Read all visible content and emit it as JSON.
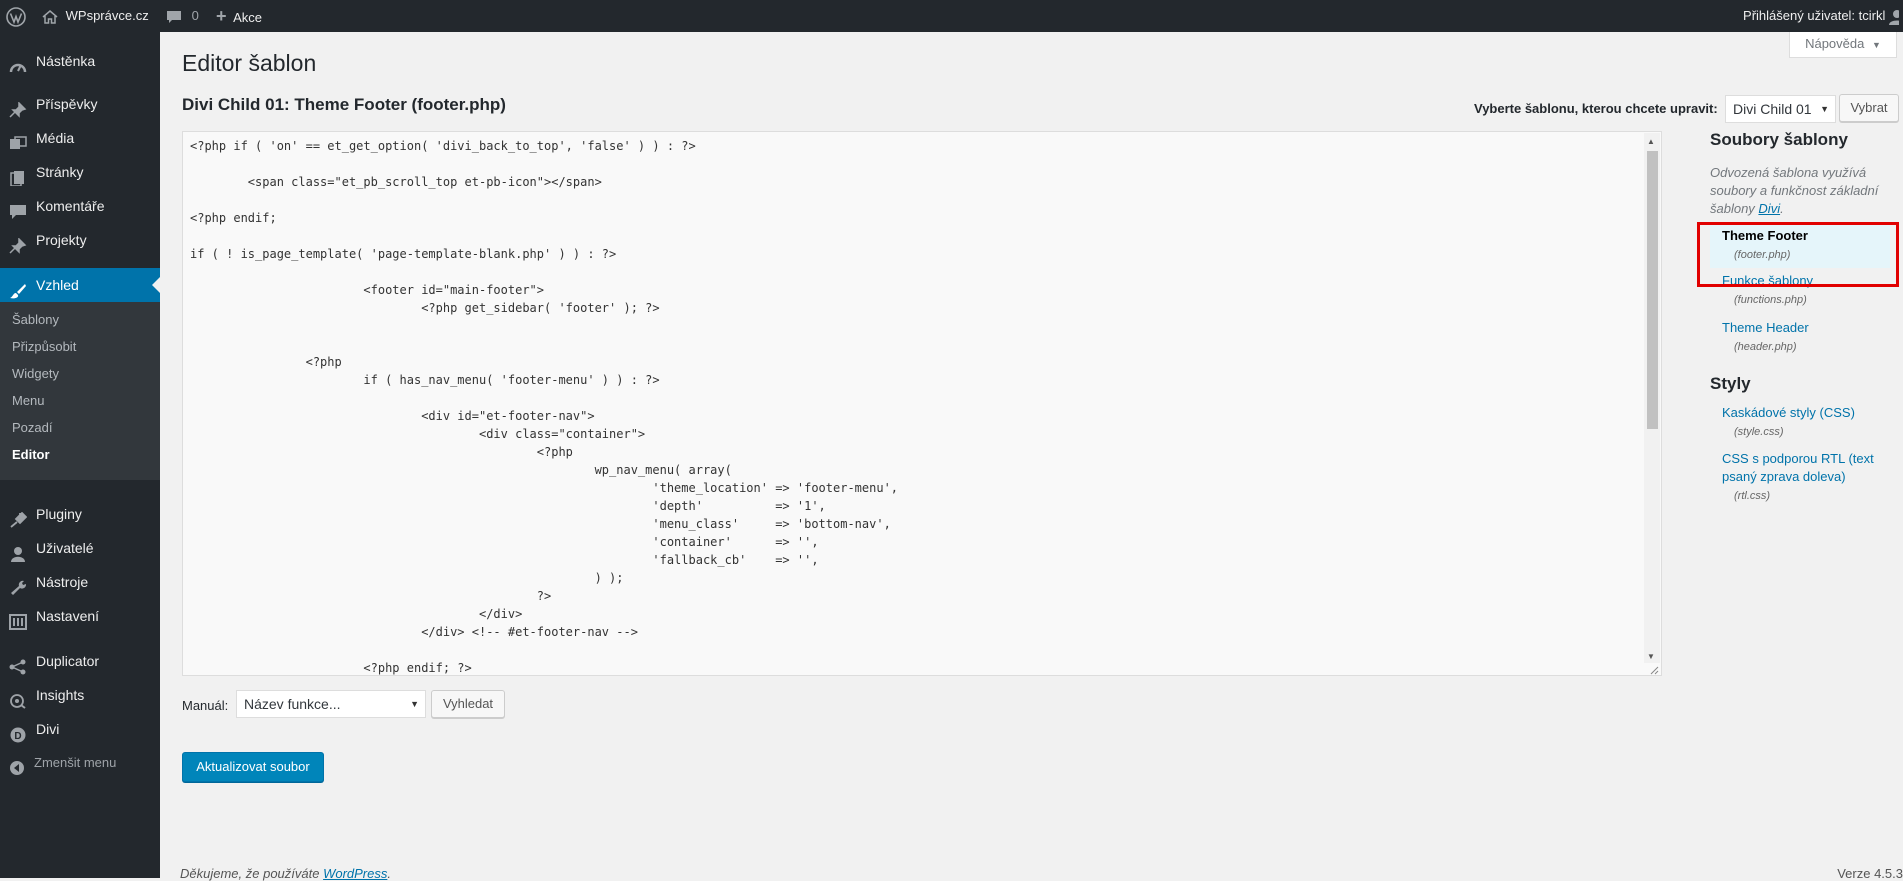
{
  "admin_bar": {
    "site_name": "WPsprávce.cz",
    "comments_count": "0",
    "new_label": "Akce",
    "user_text": "Přihlášený uživatel: tcirkl"
  },
  "sidebar": {
    "items": [
      {
        "label": "Nástěnka",
        "icon": "dashboard-icon"
      },
      {
        "label": "Příspěvky",
        "icon": "pin-icon"
      },
      {
        "label": "Média",
        "icon": "media-icon"
      },
      {
        "label": "Stránky",
        "icon": "pages-icon"
      },
      {
        "label": "Komentáře",
        "icon": "comment-icon"
      },
      {
        "label": "Projekty",
        "icon": "pin-icon"
      },
      {
        "label": "Vzhled",
        "icon": "brush-icon"
      },
      {
        "label": "Pluginy",
        "icon": "plug-icon"
      },
      {
        "label": "Uživatelé",
        "icon": "user-icon"
      },
      {
        "label": "Nástroje",
        "icon": "wrench-icon"
      },
      {
        "label": "Nastavení",
        "icon": "settings-icon"
      },
      {
        "label": "Duplicator",
        "icon": "share-icon"
      },
      {
        "label": "Insights",
        "icon": "insights-icon"
      },
      {
        "label": "Divi",
        "icon": "divi-icon"
      }
    ],
    "submenu": [
      "Šablony",
      "Přizpůsobit",
      "Widgety",
      "Menu",
      "Pozadí",
      "Editor"
    ],
    "collapse_label": "Zmenšit menu"
  },
  "main": {
    "help_label": "Nápověda",
    "page_title": "Editor šablon",
    "file_title": "Divi Child 01: Theme Footer (footer.php)",
    "select_label": "Vyberte šablonu, kterou chcete upravit:",
    "theme_select_value": "Divi Child 01",
    "select_button": "Vybrat",
    "code": "<?php if ( 'on' == et_get_option( 'divi_back_to_top', 'false' ) ) : ?>\n\n\t<span class=\"et_pb_scroll_top et-pb-icon\"></span>\n\n<?php endif;\n\nif ( ! is_page_template( 'page-template-blank.php' ) ) : ?>\n\n\t\t\t<footer id=\"main-footer\">\n\t\t\t\t<?php get_sidebar( 'footer' ); ?>\n\n\n\t\t<?php\n\t\t\tif ( has_nav_menu( 'footer-menu' ) ) : ?>\n\n\t\t\t\t<div id=\"et-footer-nav\">\n\t\t\t\t\t<div class=\"container\">\n\t\t\t\t\t\t<?php\n\t\t\t\t\t\t\twp_nav_menu( array(\n\t\t\t\t\t\t\t\t'theme_location' => 'footer-menu',\n\t\t\t\t\t\t\t\t'depth'          => '1',\n\t\t\t\t\t\t\t\t'menu_class'     => 'bottom-nav',\n\t\t\t\t\t\t\t\t'container'      => '',\n\t\t\t\t\t\t\t\t'fallback_cb'    => '',\n\t\t\t\t\t\t\t) );\n\t\t\t\t\t\t?>\n\t\t\t\t\t</div>\n\t\t\t\t</div> <!-- #et-footer-nav -->\n\n\t\t\t<?php endif; ?>",
    "manual_label": "Manuál:",
    "function_placeholder": "Název funkce...",
    "lookup_button": "Vyhledat",
    "update_button": "Aktualizovat soubor"
  },
  "files_panel": {
    "title": "Soubory šablony",
    "description_before": "Odvozená šablona využívá soubory a funkčnost základní šablony ",
    "description_link": "Divi",
    "description_after": ".",
    "templates": [
      {
        "name": "Theme Footer",
        "file": "(footer.php)",
        "current": true
      },
      {
        "name": "Funkce šablony",
        "file": "(functions.php)",
        "current": false
      },
      {
        "name": "Theme Header",
        "file": "(header.php)",
        "current": false
      }
    ],
    "styles_title": "Styly",
    "styles": [
      {
        "name": "Kaskádové styly (CSS)",
        "file": "(style.css)"
      },
      {
        "name": "CSS s podporou RTL (text psaný zprava doleva)",
        "file": "(rtl.css)"
      }
    ]
  },
  "footer": {
    "thanks_before": "Děkujeme, že používáte ",
    "thanks_link": "WordPress",
    "thanks_after": ".",
    "version": "Verze 4.5.3"
  },
  "colors": {
    "sidebar_bg": "#23282d",
    "accent": "#0073aa",
    "highlight_border": "#e10000"
  }
}
